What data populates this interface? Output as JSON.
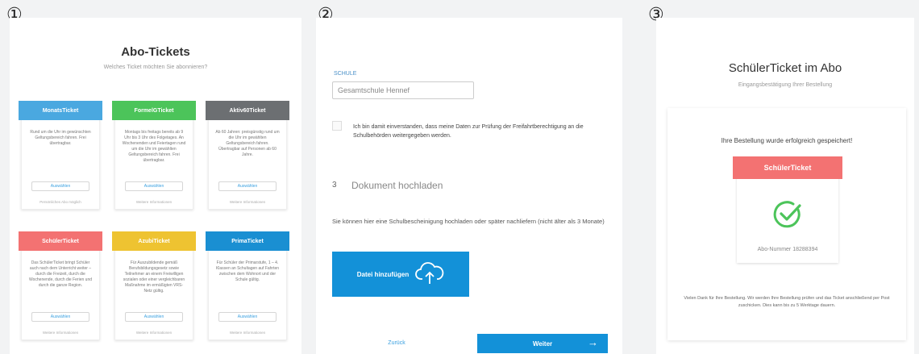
{
  "steps": [
    "①",
    "②",
    "③"
  ],
  "screen1": {
    "title": "Abo-Tickets",
    "subtitle": "Welches Ticket möchten Sie abonnieren?",
    "cards": [
      {
        "name": "MonatsTicket",
        "color": "#4aa8e0",
        "desc": "Rund um die Uhr im gewünschten Geltungsbereich fahren. Frei übertragbar.",
        "button": "Auswählen",
        "note": "Persönliches Abo möglich"
      },
      {
        "name": "FormelGTicket",
        "color": "#4cc45a",
        "desc": "Montags bis freitags bereits ab 9 Uhr bis 3 Uhr des Folgetages. An Wochenenden und Feiertagen rund um die Uhr im gewählten Geltungsbereich fahren. Frei übertragbar.",
        "button": "Auswählen",
        "note": "Weitere Informationen"
      },
      {
        "name": "Aktiv60Ticket",
        "color": "#6c6f72",
        "desc": "Ab 60 Jahren: preisgünstig rund um die Uhr im gewählten Geltungsbereich fahren. Übertragbar auf Personen ab 60 Jahre.",
        "button": "Auswählen",
        "note": "Weitere Informationen"
      },
      {
        "name": "SchülerTicket",
        "color": "#f37272",
        "desc": "Das SchülerTicket bringt Schüler auch nach dem Unterricht weiter – durch die Freizeit, durch die Wochenende, durch die Ferien und durch die ganze Region.",
        "button": "Auswählen",
        "note": "Weitere Informationen"
      },
      {
        "name": "AzubiTicket",
        "color": "#eec331",
        "desc": "Für Auszubildende gemäß Berufsbildungsgesetz sowie Teilnehmer an einem Freiwilligen sozialen oder einer vergleichbaren Maßnahme im ermäßigten VRS-Netz gültig.",
        "button": "Auswählen",
        "note": "Weitere Informationen"
      },
      {
        "name": "PrimaTicket",
        "color": "#1a8fd2",
        "desc": "Für Schüler der Primarstufe, 1 – 4. Klassen an Schultagen auf Fahrten zwischen dem Wohnort und der Schule gültig.",
        "button": "Auswählen",
        "note": "Weitere Informationen"
      }
    ]
  },
  "screen2": {
    "field_label": "SCHULE",
    "school_value": "Gesamtschule Hennef",
    "consent_text": "Ich bin damit einverstanden, dass meine Daten zur Prüfung der Freifahrtberechtigung an die Schulbehörden weitergegeben werden.",
    "step_number": "3",
    "upload_heading": "Dokument hochladen",
    "upload_desc": "Sie können hier eine Schulbescheinigung hochladen oder später nachliefern (nicht älter als 3 Monate)",
    "upload_button": "Datei hinzufügen",
    "back_button": "Zurück",
    "next_button": "Weiter",
    "next_arrow": "→"
  },
  "screen3": {
    "title": "SchülerTicket im Abo",
    "subtitle": "Eingangsbestätigung Ihrer Bestellung",
    "success_message": "Ihre Bestellung wurde erfolgreich gespeichert!",
    "ticket_name": "SchülerTicket",
    "abo_number": "Abo-Nummer 18288394",
    "thanks_text": "Vielen Dank für Ihre Bestellung. Wir werden Ihre Bestellung prüfen und das Ticket anschließend per Post zuschicken. Dies kann bis zu 5 Werktage dauern."
  },
  "colors": {
    "primary": "#1391d8",
    "success": "#4cc45a",
    "schueler": "#f37272"
  },
  "icons": {
    "upload": "cloud-upload-icon",
    "success": "check-circle-icon",
    "next": "arrow-right-icon"
  }
}
